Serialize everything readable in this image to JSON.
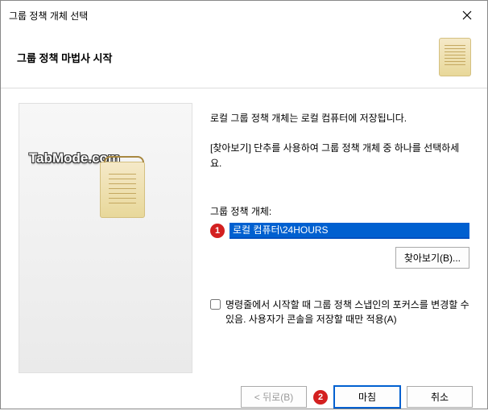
{
  "titlebar": {
    "title": "그룹 정책 개체 선택"
  },
  "header": {
    "title": "그룹 정책 마법사 시작"
  },
  "sidebar": {
    "watermark": "TabMode.com"
  },
  "main": {
    "desc1": "로컬 그룹 정책 개체는 로컬 컴퓨터에 저장됩니다.",
    "desc2": "[찾아보기] 단추를 사용하여 그룹 정책 개체 중 하나를 선택하세요.",
    "field_label": "그룹 정책 개체:",
    "input_value": "로컬 컴퓨터\\24HOURS",
    "browse_label": "찾아보기(B)...",
    "checkbox_label": "명령줄에서 시작할 때 그룹 정책 스냅인의 포커스를 변경할 수 있음. 사용자가 콘솔을 저장할 때만 적용(A)"
  },
  "footer": {
    "back_label": "< 뒤로(B)",
    "finish_label": "마침",
    "cancel_label": "취소"
  },
  "annotations": {
    "step1": "1",
    "step2": "2"
  }
}
